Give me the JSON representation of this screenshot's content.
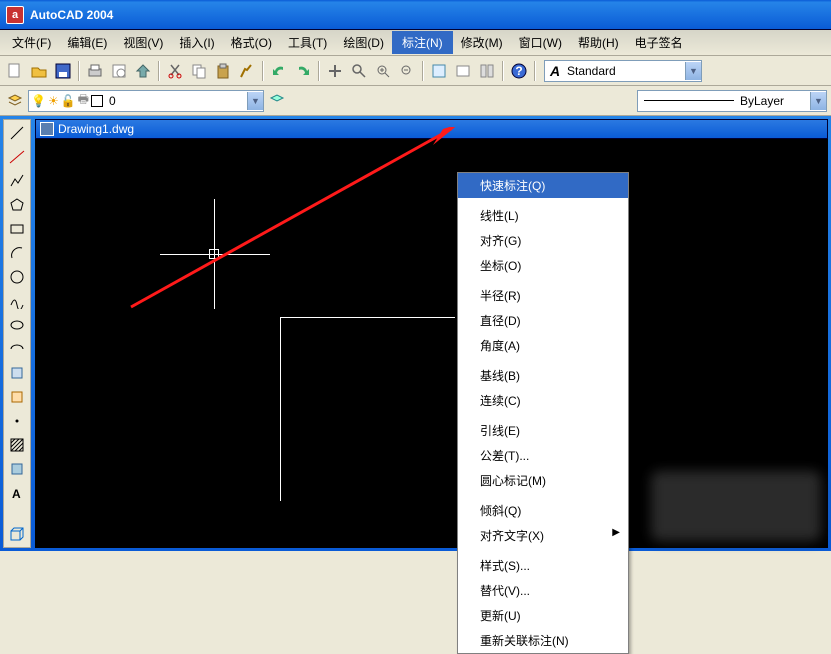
{
  "app": {
    "title": "AutoCAD 2004",
    "icon_letter": "a"
  },
  "menubar": {
    "items": [
      {
        "label": "文件(F)"
      },
      {
        "label": "编辑(E)"
      },
      {
        "label": "视图(V)"
      },
      {
        "label": "插入(I)"
      },
      {
        "label": "格式(O)"
      },
      {
        "label": "工具(T)"
      },
      {
        "label": "绘图(D)"
      },
      {
        "label": "标注(N)",
        "active": true
      },
      {
        "label": "修改(M)"
      },
      {
        "label": "窗口(W)"
      },
      {
        "label": "帮助(H)"
      },
      {
        "label": "电子签名"
      }
    ]
  },
  "toolbar1": {
    "style_swatch": "A",
    "style_value": "Standard"
  },
  "toolbar2": {
    "layer_value": "0",
    "bylayer_value": "ByLayer"
  },
  "document": {
    "title": "Drawing1.dwg"
  },
  "dropdown": {
    "groups": [
      [
        {
          "label": "快速标注(Q)",
          "highlight": true
        }
      ],
      [
        {
          "label": "线性(L)"
        },
        {
          "label": "对齐(G)"
        },
        {
          "label": "坐标(O)"
        }
      ],
      [
        {
          "label": "半径(R)"
        },
        {
          "label": "直径(D)"
        },
        {
          "label": "角度(A)"
        }
      ],
      [
        {
          "label": "基线(B)"
        },
        {
          "label": "连续(C)"
        }
      ],
      [
        {
          "label": "引线(E)"
        },
        {
          "label": "公差(T)..."
        },
        {
          "label": "圆心标记(M)"
        }
      ],
      [
        {
          "label": "倾斜(Q)"
        },
        {
          "label": "对齐文字(X)",
          "submenu": true
        }
      ],
      [
        {
          "label": "样式(S)..."
        },
        {
          "label": "替代(V)..."
        },
        {
          "label": "更新(U)"
        },
        {
          "label": "重新关联标注(N)"
        }
      ]
    ]
  },
  "left_tools": [
    "line",
    "cline",
    "pline",
    "poly",
    "rect",
    "arc",
    "circle",
    "spline",
    "ell",
    "earc",
    "block",
    "point",
    "hatch",
    "region",
    "text",
    "box"
  ]
}
